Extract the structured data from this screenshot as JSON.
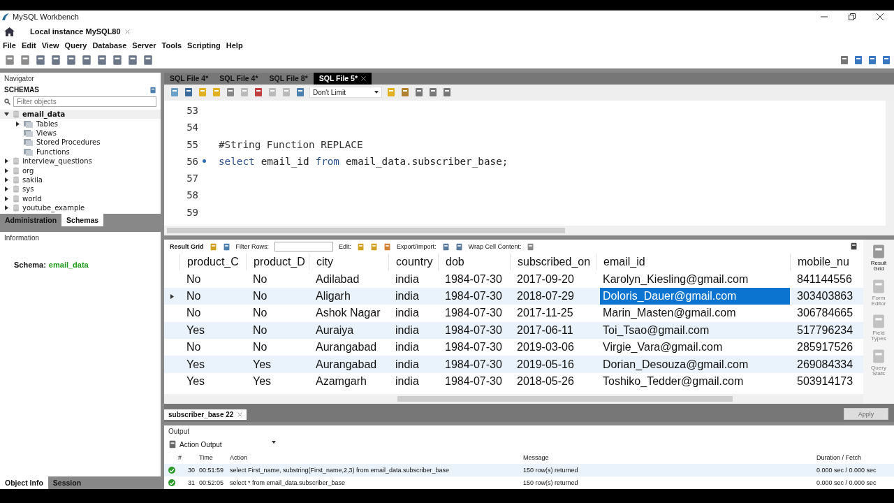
{
  "window": {
    "title": "MySQL Workbench"
  },
  "connection_tab": {
    "label": "Local instance MySQL80"
  },
  "menu": [
    "File",
    "Edit",
    "View",
    "Query",
    "Database",
    "Server",
    "Tools",
    "Scripting",
    "Help"
  ],
  "navigator": {
    "title": "Navigator",
    "section": "SCHEMAS",
    "filter_placeholder": "Filter objects",
    "schemas": [
      {
        "name": "email_data",
        "expanded": true,
        "children": [
          {
            "name": "Tables",
            "expandable": true
          },
          {
            "name": "Views",
            "expandable": false
          },
          {
            "name": "Stored Procedures",
            "expandable": false
          },
          {
            "name": "Functions",
            "expandable": false
          }
        ]
      },
      {
        "name": "interview_questions",
        "expanded": false
      },
      {
        "name": "org",
        "expanded": false
      },
      {
        "name": "sakila",
        "expanded": false
      },
      {
        "name": "sys",
        "expanded": false
      },
      {
        "name": "world",
        "expanded": false
      },
      {
        "name": "youtube_example",
        "expanded": false
      }
    ]
  },
  "left_tabs": [
    {
      "label": "Administration",
      "selected": false
    },
    {
      "label": "Schemas",
      "selected": true
    }
  ],
  "information": {
    "title": "Information",
    "schema_label": "Schema:",
    "schema_value": "email_data"
  },
  "bottom_left_tabs": [
    {
      "label": "Object Info",
      "selected": true
    },
    {
      "label": "Session",
      "selected": false
    }
  ],
  "sql_tabs": [
    {
      "label": "SQL File 4*",
      "selected": false
    },
    {
      "label": "SQL File 4*",
      "selected": false
    },
    {
      "label": "SQL File 8*",
      "selected": false
    },
    {
      "label": "SQL File 5*",
      "selected": true
    }
  ],
  "limit": "Don't Limit",
  "editor": {
    "lines": [
      {
        "number": "53",
        "marker": false
      },
      {
        "number": "54",
        "marker": false
      },
      {
        "number": "55",
        "marker": false,
        "tokens": [
          {
            "text": "#String Function REPLACE",
            "kind": "comment"
          }
        ]
      },
      {
        "number": "56",
        "marker": true,
        "tokens": [
          {
            "text": "select",
            "kind": "keyword"
          },
          {
            "text": "email_id",
            "kind": "plain"
          },
          {
            "text": "from",
            "kind": "keyword"
          },
          {
            "text": "email_data.subscriber_base;",
            "kind": "plain"
          }
        ]
      },
      {
        "number": "57",
        "marker": false
      },
      {
        "number": "58",
        "marker": false
      },
      {
        "number": "59",
        "marker": false
      }
    ]
  },
  "result_toolbar": {
    "title": "Result Grid",
    "filter_label": "Filter Rows:",
    "edit_label": "Edit:",
    "export_label": "Export/Import:",
    "wrap_label": "Wrap Cell Content:"
  },
  "grid": {
    "columns": [
      "product_C",
      "product_D",
      "city",
      "country",
      "dob",
      "subscribed_on",
      "email_id",
      "mobile_nu"
    ],
    "rows": [
      {
        "selected": false,
        "cells": [
          {
            "text": "No",
            "selected": false
          },
          {
            "text": "No",
            "selected": false
          },
          {
            "text": "Adilabad",
            "selected": false
          },
          {
            "text": "india",
            "selected": false
          },
          {
            "text": "1984-07-30",
            "selected": false
          },
          {
            "text": "2017-09-20",
            "selected": false
          },
          {
            "text": "Karolyn_Kiesling@gmail.com",
            "selected": false
          },
          {
            "text": "841144556",
            "selected": false
          }
        ]
      },
      {
        "selected": true,
        "cells": [
          {
            "text": "No",
            "selected": false
          },
          {
            "text": "No",
            "selected": false
          },
          {
            "text": "Aligarh",
            "selected": false
          },
          {
            "text": "india",
            "selected": false
          },
          {
            "text": "1984-07-30",
            "selected": false
          },
          {
            "text": "2018-07-29",
            "selected": false
          },
          {
            "text": "Doloris_Dauer@gmail.com",
            "selected": true
          },
          {
            "text": "303403863",
            "selected": false
          }
        ]
      },
      {
        "selected": false,
        "cells": [
          {
            "text": "No",
            "selected": false
          },
          {
            "text": "No",
            "selected": false
          },
          {
            "text": "Ashok Nagar",
            "selected": false
          },
          {
            "text": "india",
            "selected": false
          },
          {
            "text": "1984-07-30",
            "selected": false
          },
          {
            "text": "2017-11-25",
            "selected": false
          },
          {
            "text": "Marin_Masten@gmail.com",
            "selected": false
          },
          {
            "text": "306784665",
            "selected": false
          }
        ]
      },
      {
        "selected": false,
        "cells": [
          {
            "text": "Yes",
            "selected": false
          },
          {
            "text": "No",
            "selected": false
          },
          {
            "text": "Auraiya",
            "selected": false
          },
          {
            "text": "india",
            "selected": false
          },
          {
            "text": "1984-07-30",
            "selected": false
          },
          {
            "text": "2017-06-11",
            "selected": false
          },
          {
            "text": "Toi_Tsao@gmail.com",
            "selected": false
          },
          {
            "text": "517796234",
            "selected": false
          }
        ]
      },
      {
        "selected": false,
        "cells": [
          {
            "text": "No",
            "selected": false
          },
          {
            "text": "No",
            "selected": false
          },
          {
            "text": "Aurangabad",
            "selected": false
          },
          {
            "text": "india",
            "selected": false
          },
          {
            "text": "1984-07-30",
            "selected": false
          },
          {
            "text": "2019-03-06",
            "selected": false
          },
          {
            "text": "Virgie_Vara@gmail.com",
            "selected": false
          },
          {
            "text": "285917526",
            "selected": false
          }
        ]
      },
      {
        "selected": false,
        "cells": [
          {
            "text": "Yes",
            "selected": false
          },
          {
            "text": "Yes",
            "selected": false
          },
          {
            "text": "Aurangabad",
            "selected": false
          },
          {
            "text": "india",
            "selected": false
          },
          {
            "text": "1984-07-30",
            "selected": false
          },
          {
            "text": "2019-05-16",
            "selected": false
          },
          {
            "text": "Dorian_Desouza@gmail.com",
            "selected": false
          },
          {
            "text": "269084334",
            "selected": false
          }
        ]
      },
      {
        "selected": false,
        "cells": [
          {
            "text": "Yes",
            "selected": false
          },
          {
            "text": "Yes",
            "selected": false
          },
          {
            "text": "Azamgarh",
            "selected": false
          },
          {
            "text": "india",
            "selected": false
          },
          {
            "text": "1984-07-30",
            "selected": false
          },
          {
            "text": "2018-05-26",
            "selected": false
          },
          {
            "text": "Toshiko_Tedder@gmail.com",
            "selected": false
          },
          {
            "text": "503914173",
            "selected": false
          }
        ]
      }
    ]
  },
  "side_panel": [
    {
      "label": "Result Grid",
      "selected": true
    },
    {
      "label": "Form Editor",
      "selected": false
    },
    {
      "label": "Field Types",
      "selected": false
    },
    {
      "label": "Query Stats",
      "selected": false
    }
  ],
  "apply_button": {
    "label": "Apply",
    "disabled": true
  },
  "result_tab": {
    "label": "subscriber_base 22"
  },
  "output": {
    "title": "Output",
    "selector": "Action Output",
    "columns": [
      "#",
      "Time",
      "Action",
      "Message",
      "Duration / Fetch"
    ],
    "rows": [
      {
        "succeeded": true,
        "cells": [
          "30",
          "00:51:59",
          "select First_name, substring(First_name,2,3)  from email_data.subscriber_base",
          "150 row(s) returned",
          "0.000 sec / 0.000 sec"
        ]
      },
      {
        "succeeded": true,
        "cells": [
          "31",
          "00:52:05",
          "select * from email_data.subscriber_base",
          "150 row(s) returned",
          "0.000 sec / 0.000 sec"
        ]
      }
    ]
  }
}
